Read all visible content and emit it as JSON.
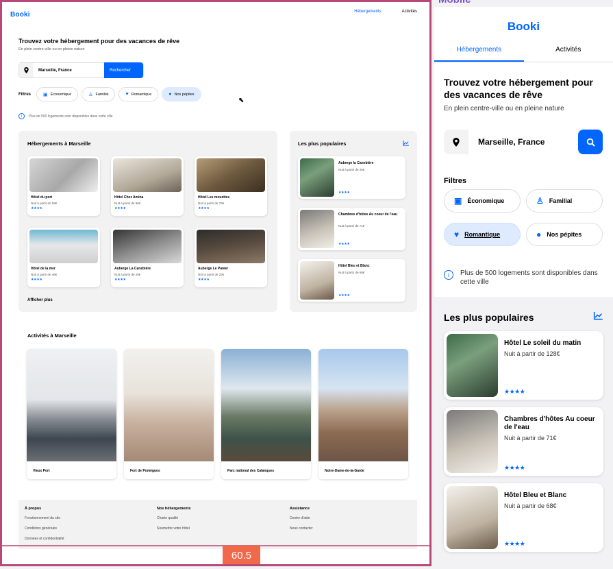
{
  "colors": {
    "accent": "#0065fc",
    "chip_selected": "#deebff",
    "frame": "#b8487a",
    "badge": "#f06a4a",
    "mobile_label": "#7a55c0"
  },
  "desktop": {
    "logo": "Booki",
    "nav": [
      "Hébergements",
      "Activités"
    ],
    "hero": {
      "title": "Trouvez votre hébergement pour des vacances de rêve",
      "subtitle": "En plein centre-ville ou en pleine nature"
    },
    "search": {
      "city": "Marseille, France",
      "button": "Rechercher",
      "pin_icon": "location-pin-icon"
    },
    "filters": {
      "label": "Filtres",
      "items": [
        {
          "label": "Économique",
          "icon": "money-icon"
        },
        {
          "label": "Familial",
          "icon": "child-icon"
        },
        {
          "label": "Romantique",
          "icon": "heart-icon"
        },
        {
          "label": "Nos pépites",
          "icon": "flame-icon",
          "selected": true
        }
      ]
    },
    "info": "Plus de 500 logements sont disponibles dans cette ville",
    "lodgings": {
      "title": "Hébergements à Marseille",
      "more": "Afficher plus",
      "items": [
        {
          "name": "Hôtel du port",
          "price": "Nuit à partir de 52€",
          "stars": "★★★★"
        },
        {
          "name": "Hôtel Chez Amina",
          "price": "Nuit à partir de 96€",
          "stars": "★★★★"
        },
        {
          "name": "Hôtel Les mouettes",
          "price": "Nuit à partir de 76€",
          "stars": "★★★★"
        },
        {
          "name": "Hôtel de la mer",
          "price": "Nuit à partir de 46€",
          "stars": "★★★★"
        },
        {
          "name": "Auberge La Canebière",
          "price": "Nuit à partir de 25€",
          "stars": "★★★★"
        },
        {
          "name": "Auberge Le Panier",
          "price": "Nuit à partir de 23€",
          "stars": "★★★★"
        }
      ]
    },
    "popular": {
      "title": "Les plus populaires",
      "items": [
        {
          "name": "Auberge la Canebière",
          "price": "Nuit à partir de 25€",
          "stars": "★★★★"
        },
        {
          "name": "Chambres d'hôtes Au coeur de l'eau",
          "price": "Nuit à partir de 71€",
          "stars": "★★★★"
        },
        {
          "name": "Hôtel Bleu et Blanc",
          "price": "Nuit à partir de 68€",
          "stars": "★★★★"
        }
      ]
    },
    "activities": {
      "title": "Activités à Marseille",
      "items": [
        "Vieux Port",
        "Fort de Pomègues",
        "Parc national des Calanques",
        "Notre-Dame-de-la-Garde"
      ]
    },
    "footer": {
      "columns": [
        {
          "title": "À propos",
          "links": [
            "Fonctionnement du site",
            "Conditions générales",
            "Données et confidentialité"
          ]
        },
        {
          "title": "Nos hébergements",
          "links": [
            "Charte qualité",
            "Soumettre votre hôtel"
          ]
        },
        {
          "title": "Assistance",
          "links": [
            "Centre d'aide",
            "Nous contacter"
          ]
        }
      ]
    },
    "badge": "60.5"
  },
  "mobile": {
    "label": "Mobile",
    "logo": "Booki",
    "tabs": [
      "Hébergements",
      "Activités"
    ],
    "hero": {
      "title": "Trouvez votre hébergement pour des vacances de rêve",
      "subtitle": "En plein centre-ville ou en pleine nature"
    },
    "search": {
      "city": "Marseille, France"
    },
    "filters": {
      "label": "Filtres",
      "items": [
        {
          "label": "Économique",
          "icon": "money-icon"
        },
        {
          "label": "Familial",
          "icon": "child-icon"
        },
        {
          "label": "Romantique",
          "icon": "heart-icon",
          "selected": true
        },
        {
          "label": "Nos pépites",
          "icon": "flame-icon"
        }
      ]
    },
    "info": "Plus de 500 logements sont disponibles dans cette ville",
    "popular": {
      "title": "Les plus populaires",
      "items": [
        {
          "name": "Hôtel Le soleil du matin",
          "price": "Nuit à partir de 128€",
          "stars": "★★★★"
        },
        {
          "name": "Chambres d'hôtes Au coeur de l'eau",
          "price": "Nuit à partir de 71€",
          "stars": "★★★★"
        },
        {
          "name": "Hôtel Bleu et Blanc",
          "price": "Nuit à partir de 68€",
          "stars": "★★★★"
        }
      ]
    }
  }
}
